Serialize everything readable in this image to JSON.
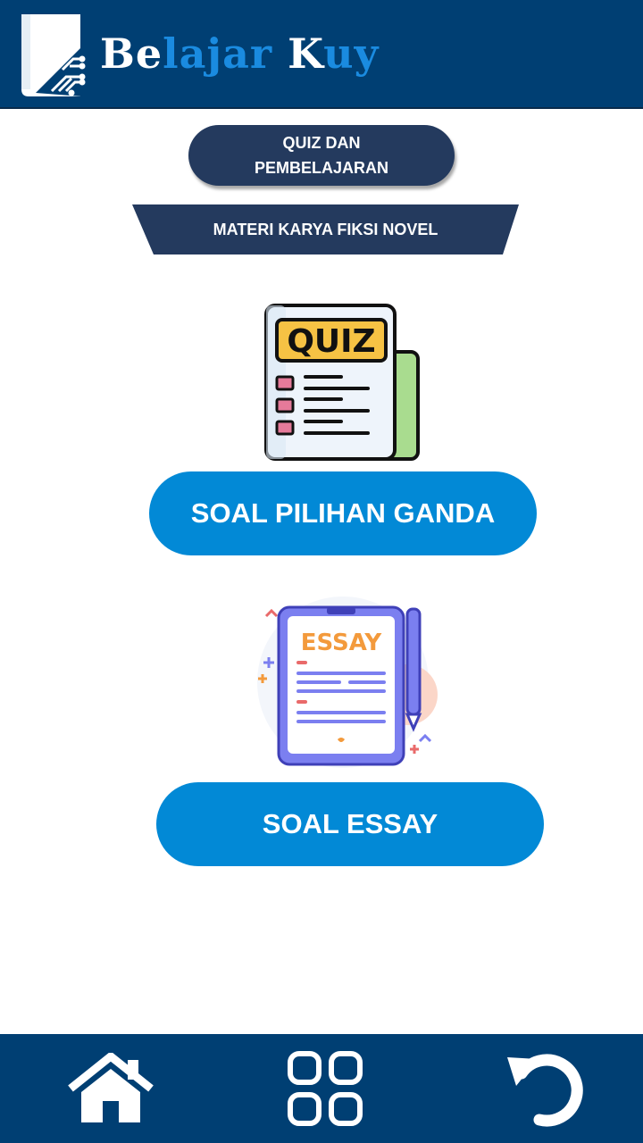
{
  "header": {
    "brand_parts": [
      {
        "text": "Be",
        "style": "white"
      },
      {
        "text": "lajar ",
        "style": "blue"
      },
      {
        "text": "K",
        "style": "white"
      },
      {
        "text": "uy",
        "style": "blue"
      }
    ],
    "logo_icon": "book-circuit-icon"
  },
  "quiz_pill": {
    "line1": "QUIZ DAN",
    "line2": "PEMBELAJARAN"
  },
  "section_banner": {
    "label": "MATERI KARYA FIKSI NOVEL"
  },
  "quiz_illustration": {
    "text": "QUIZ",
    "icon": "quiz-sheet-icon"
  },
  "essay_illustration": {
    "text": "ESSAY",
    "icon": "essay-tablet-icon"
  },
  "buttons": {
    "multiple_choice": "SOAL PILIHAN GANDA",
    "essay": "SOAL ESSAY"
  },
  "bottom_nav": {
    "items": [
      {
        "icon": "home-icon"
      },
      {
        "icon": "grid-menu-icon"
      },
      {
        "icon": "back-arrow-icon"
      }
    ]
  },
  "colors": {
    "header_bg": "#003f73",
    "brand_blue": "#1a8be0",
    "pill_bg": "#243a5e",
    "button_bg": "#0289d6"
  }
}
